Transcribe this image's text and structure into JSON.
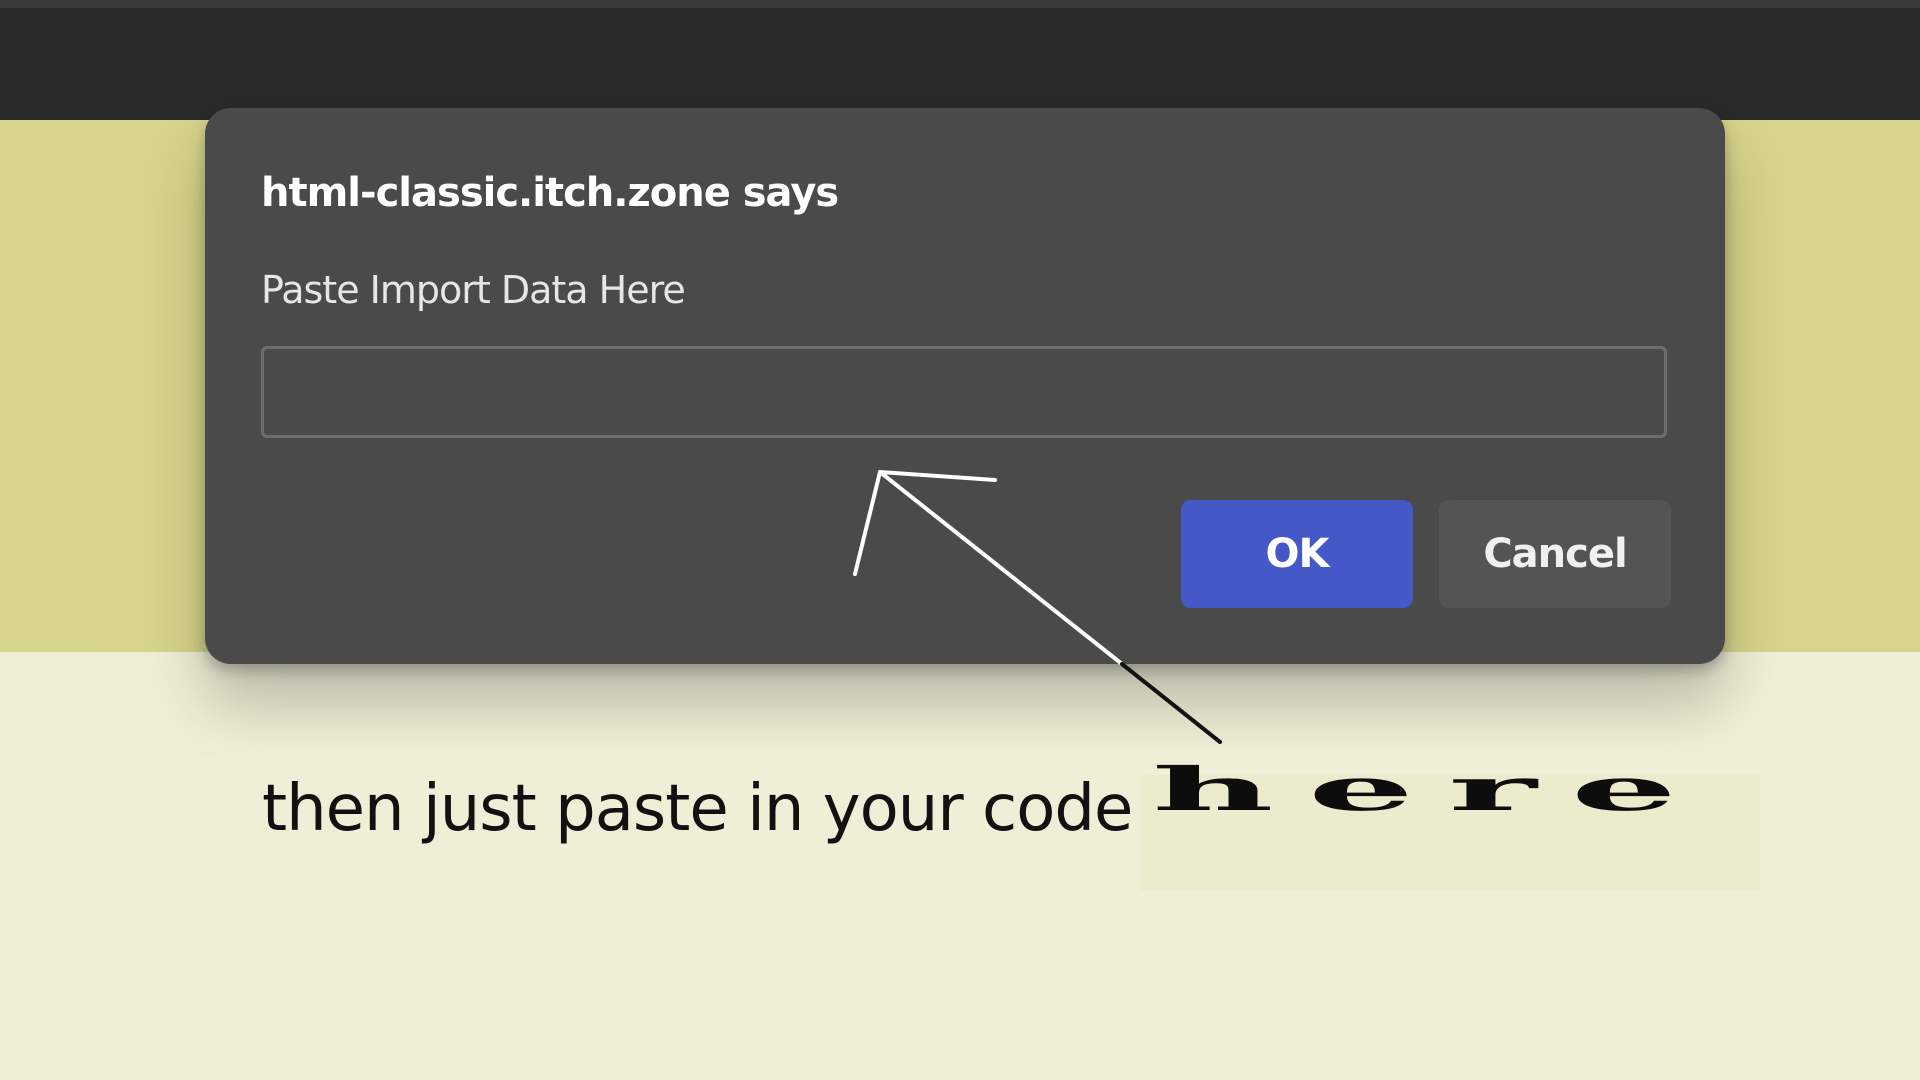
{
  "dialog": {
    "title": "html-classic.itch.zone says",
    "message": "Paste Import Data Here",
    "input_value": "",
    "ok_label": "OK",
    "cancel_label": "Cancel",
    "colors": {
      "background": "#4a4a4a",
      "ok_button": "#4558c8",
      "cancel_button": "#545454"
    }
  },
  "annotation": {
    "caption": "then just paste in your code",
    "emphasis": "here",
    "arrow_icon": "hand-drawn-arrow-icon"
  },
  "page": {
    "colors": {
      "top_bar": "#2b2b2b",
      "band": "#d6d48a",
      "background": "#efeed6"
    }
  }
}
